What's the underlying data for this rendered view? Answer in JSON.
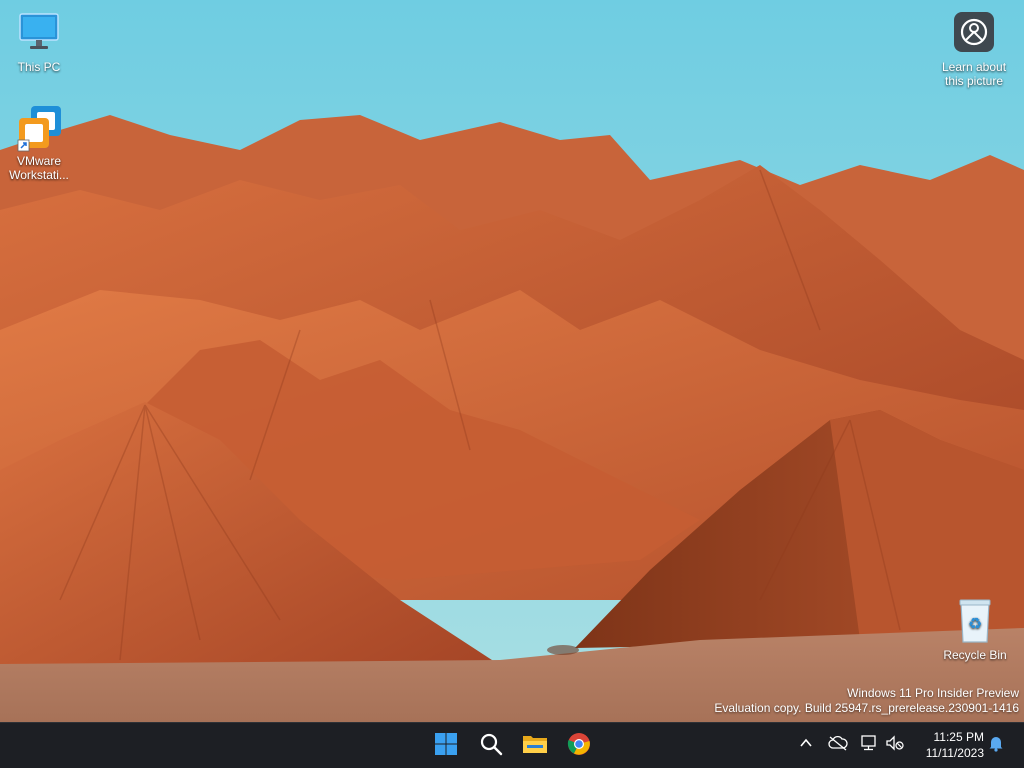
{
  "desktop": {
    "icons": [
      {
        "label": "This PC",
        "icon": "monitor-icon"
      },
      {
        "label": "VMware Workstati...",
        "icon": "vmware-icon"
      },
      {
        "label": "Learn about this picture",
        "icon": "camera-info-icon"
      },
      {
        "label": "Recycle Bin",
        "icon": "recycle-bin-icon"
      }
    ],
    "watermark": {
      "line1": "Windows 11 Pro Insider Preview",
      "line2": "Evaluation copy. Build 25947.rs_prerelease.230901-1416"
    }
  },
  "taskbar": {
    "apps": [
      {
        "name": "Start",
        "icon": "windows-start-icon"
      },
      {
        "name": "Search",
        "icon": "search-icon"
      },
      {
        "name": "File Explorer",
        "icon": "folder-icon"
      },
      {
        "name": "Google Chrome",
        "icon": "chrome-icon"
      }
    ],
    "tray": {
      "icons": [
        "chevron-up-icon",
        "cloud-offline-icon",
        "network-icon",
        "volume-muted-icon",
        "notification-bell-icon"
      ],
      "time": "11:25 PM",
      "date": "11/11/2023"
    }
  },
  "colors": {
    "sky": "#7fd3e4",
    "rock": "#c65f33",
    "taskbar": "#1d1f24",
    "windows_blue": "#3aa0f0"
  }
}
